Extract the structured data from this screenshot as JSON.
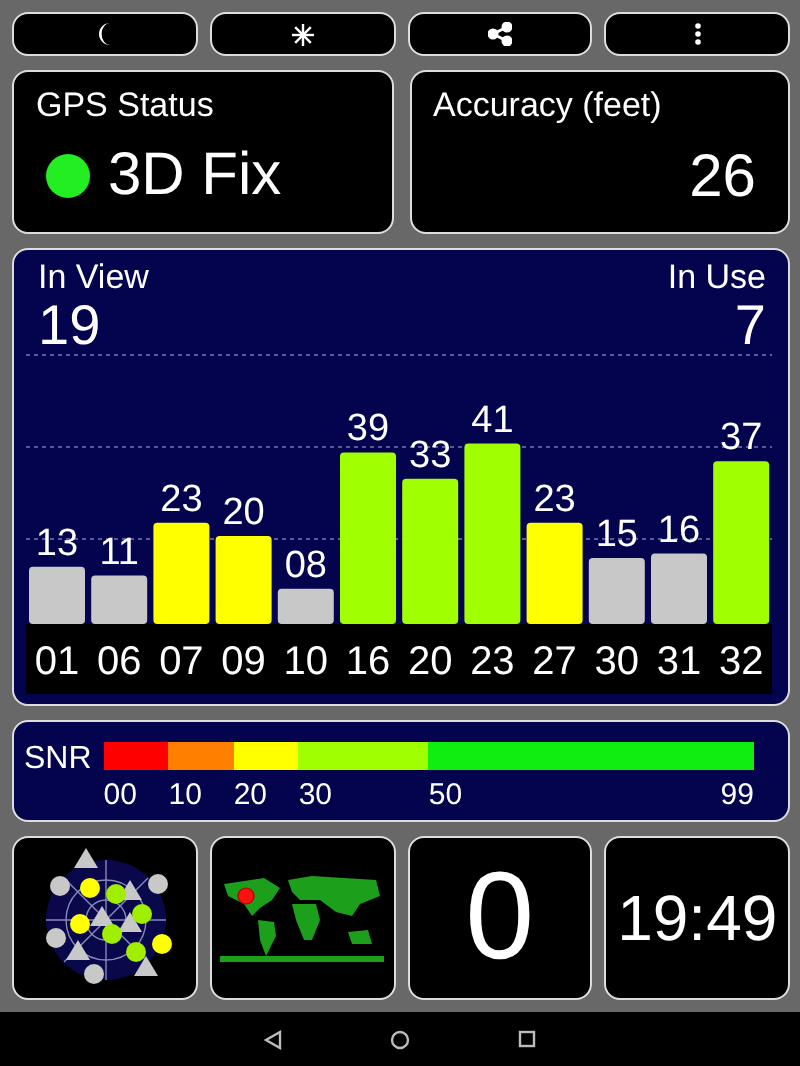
{
  "gps_status": {
    "label": "GPS Status",
    "value": "3D Fix",
    "color": "#22ee22"
  },
  "accuracy": {
    "label": "Accuracy (feet)",
    "value": "26"
  },
  "satellite_chart": {
    "in_view_label": "In View",
    "in_view": "19",
    "in_use_label": "In Use",
    "in_use_count": "7",
    "in_use": [
      false,
      false,
      true,
      true,
      false,
      true,
      true,
      true,
      true,
      false,
      false,
      true
    ],
    "chart_data": {
      "type": "bar",
      "categories": [
        "01",
        "06",
        "07",
        "09",
        "10",
        "16",
        "20",
        "23",
        "27",
        "30",
        "31",
        "32"
      ],
      "values": [
        13,
        11,
        23,
        20,
        8,
        39,
        33,
        41,
        23,
        15,
        16,
        37
      ],
      "value_labels": [
        "13",
        "11",
        "23",
        "20",
        "08",
        "39",
        "33",
        "41",
        "23",
        "15",
        "16",
        "37"
      ]
    }
  },
  "snr_legend": {
    "label": "SNR",
    "segments": [
      {
        "color": "#ff0000",
        "label": "00"
      },
      {
        "color": "#ff8000",
        "label": "10"
      },
      {
        "color": "#ffff00",
        "label": "20"
      },
      {
        "color": "#a0ff00",
        "label": "30"
      },
      {
        "color": "#10ee10",
        "label": "50"
      }
    ],
    "end_label": "99"
  },
  "tiles": [
    {
      "kind": "skyplot"
    },
    {
      "kind": "map"
    },
    {
      "kind": "value",
      "text": "0"
    },
    {
      "kind": "clock",
      "text": "19:49"
    }
  ]
}
